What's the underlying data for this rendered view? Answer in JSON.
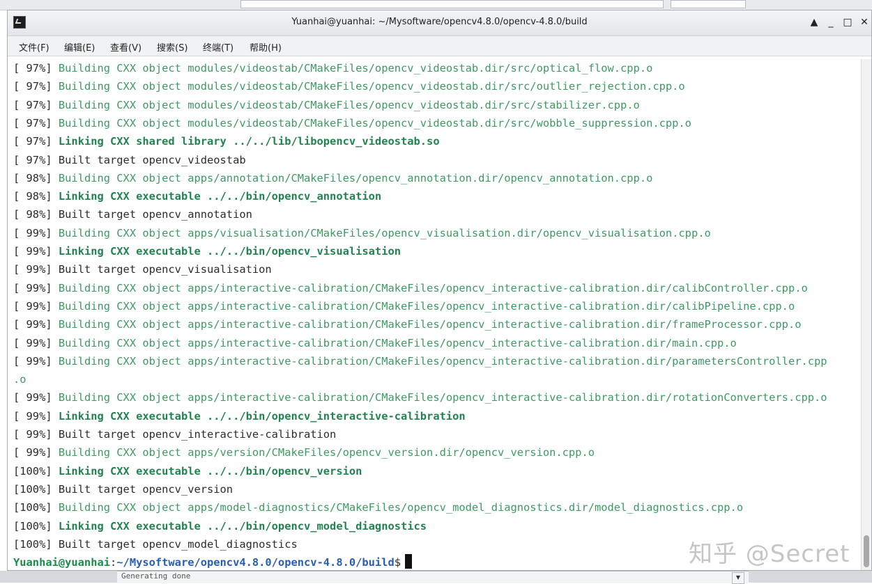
{
  "window": {
    "title": "Yuanhai@yuanhai: ~/Mysoftware/opencv4.8.0/opencv-4.8.0/build",
    "controls": {
      "up": "▲",
      "minimize": "_",
      "maximize": "□",
      "close": "✕"
    }
  },
  "menu": [
    "文件(F)",
    "编辑(E)",
    "查看(V)",
    "搜索(S)",
    "终端(T)",
    "帮助(H)"
  ],
  "terminal": {
    "lines": [
      {
        "pct": "[ 97%]",
        "type": "building",
        "text": "Building CXX object modules/videostab/CMakeFiles/opencv_videostab.dir/src/optical_flow.cpp.o"
      },
      {
        "pct": "[ 97%]",
        "type": "building",
        "text": "Building CXX object modules/videostab/CMakeFiles/opencv_videostab.dir/src/outlier_rejection.cpp.o"
      },
      {
        "pct": "[ 97%]",
        "type": "building",
        "text": "Building CXX object modules/videostab/CMakeFiles/opencv_videostab.dir/src/stabilizer.cpp.o"
      },
      {
        "pct": "[ 97%]",
        "type": "building",
        "text": "Building CXX object modules/videostab/CMakeFiles/opencv_videostab.dir/src/wobble_suppression.cpp.o"
      },
      {
        "pct": "[ 97%]",
        "type": "linking",
        "text": "Linking CXX shared library ../../lib/libopencv_videostab.so"
      },
      {
        "pct": "[ 97%]",
        "type": "built",
        "text": "Built target opencv_videostab"
      },
      {
        "pct": "[ 98%]",
        "type": "building",
        "text": "Building CXX object apps/annotation/CMakeFiles/opencv_annotation.dir/opencv_annotation.cpp.o"
      },
      {
        "pct": "[ 98%]",
        "type": "linking",
        "text": "Linking CXX executable ../../bin/opencv_annotation"
      },
      {
        "pct": "[ 98%]",
        "type": "built",
        "text": "Built target opencv_annotation"
      },
      {
        "pct": "[ 99%]",
        "type": "building",
        "text": "Building CXX object apps/visualisation/CMakeFiles/opencv_visualisation.dir/opencv_visualisation.cpp.o"
      },
      {
        "pct": "[ 99%]",
        "type": "linking",
        "text": "Linking CXX executable ../../bin/opencv_visualisation"
      },
      {
        "pct": "[ 99%]",
        "type": "built",
        "text": "Built target opencv_visualisation"
      },
      {
        "pct": "[ 99%]",
        "type": "building",
        "text": "Building CXX object apps/interactive-calibration/CMakeFiles/opencv_interactive-calibration.dir/calibController.cpp.o"
      },
      {
        "pct": "[ 99%]",
        "type": "building",
        "text": "Building CXX object apps/interactive-calibration/CMakeFiles/opencv_interactive-calibration.dir/calibPipeline.cpp.o"
      },
      {
        "pct": "[ 99%]",
        "type": "building",
        "text": "Building CXX object apps/interactive-calibration/CMakeFiles/opencv_interactive-calibration.dir/frameProcessor.cpp.o"
      },
      {
        "pct": "[ 99%]",
        "type": "building",
        "text": "Building CXX object apps/interactive-calibration/CMakeFiles/opencv_interactive-calibration.dir/main.cpp.o"
      },
      {
        "pct": "[ 99%]",
        "type": "building",
        "text": "Building CXX object apps/interactive-calibration/CMakeFiles/opencv_interactive-calibration.dir/parametersController.cpp"
      },
      {
        "pct": "",
        "type": "building",
        "text": ".o"
      },
      {
        "pct": "[ 99%]",
        "type": "building",
        "text": "Building CXX object apps/interactive-calibration/CMakeFiles/opencv_interactive-calibration.dir/rotationConverters.cpp.o"
      },
      {
        "pct": "[ 99%]",
        "type": "linking",
        "text": "Linking CXX executable ../../bin/opencv_interactive-calibration"
      },
      {
        "pct": "[ 99%]",
        "type": "built",
        "text": "Built target opencv_interactive-calibration"
      },
      {
        "pct": "[ 99%]",
        "type": "building",
        "text": "Building CXX object apps/version/CMakeFiles/opencv_version.dir/opencv_version.cpp.o"
      },
      {
        "pct": "[100%]",
        "type": "linking",
        "text": "Linking CXX executable ../../bin/opencv_version"
      },
      {
        "pct": "[100%]",
        "type": "built",
        "text": "Built target opencv_version"
      },
      {
        "pct": "[100%]",
        "type": "building",
        "text": "Building CXX object apps/model-diagnostics/CMakeFiles/opencv_model_diagnostics.dir/model_diagnostics.cpp.o"
      },
      {
        "pct": "[100%]",
        "type": "linking",
        "text": "Linking CXX executable ../../bin/opencv_model_diagnostics"
      },
      {
        "pct": "[100%]",
        "type": "built",
        "text": "Built target opencv_model_diagnostics"
      }
    ],
    "prompt": {
      "user": "Yuanhai@yuanhai",
      "colon": ":",
      "path": "~/Mysoftware/opencv4.8.0/opencv-4.8.0/build",
      "dollar": "$"
    }
  },
  "background": {
    "bottom_text": "Generating done"
  },
  "watermark": "知乎 @Secret",
  "colors": {
    "building": "#3c9a62",
    "linking": "#218350",
    "path": "#2a5fb0"
  }
}
